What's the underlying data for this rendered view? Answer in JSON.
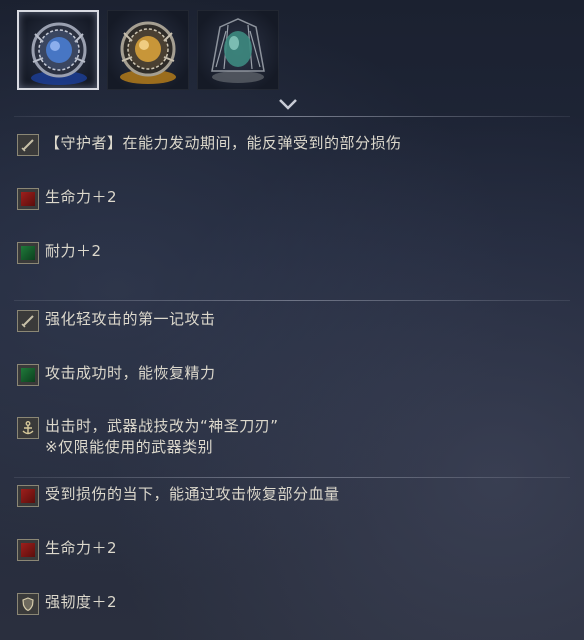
{
  "relics": [
    {
      "icon": "blue-relic-icon",
      "color": "#4a7fd6",
      "selected": true
    },
    {
      "icon": "gold-relic-icon",
      "color": "#d6a03a",
      "selected": false
    },
    {
      "icon": "teal-relic-icon",
      "color": "#4fa89a",
      "selected": false
    }
  ],
  "effect_groups": [
    {
      "effects": [
        {
          "icon": "sword-icon",
          "icon_color": "grey",
          "text": "【守护者】在能力发动期间，能反弹受到的部分损伤"
        },
        {
          "icon": "red-square-icon",
          "icon_color": "red",
          "text": "生命力＋2"
        },
        {
          "icon": "green-square-icon",
          "icon_color": "green",
          "text": "耐力＋2"
        }
      ]
    },
    {
      "effects": [
        {
          "icon": "sword-icon",
          "icon_color": "grey",
          "text": "强化轻攻击的第一记攻击"
        },
        {
          "icon": "green-square-icon",
          "icon_color": "green",
          "text": "攻击成功时，能恢复精力"
        },
        {
          "icon": "anchor-icon",
          "icon_color": "grey",
          "text": "出击时，武器战技改为“神圣刀刃”",
          "note": "※仅限能使用的武器类别"
        }
      ]
    },
    {
      "effects": [
        {
          "icon": "red-square-icon",
          "icon_color": "red",
          "text": "受到损伤的当下，能通过攻击恢复部分血量"
        },
        {
          "icon": "red-square-icon",
          "icon_color": "red",
          "text": "生命力＋2"
        },
        {
          "icon": "shield-icon",
          "icon_color": "grey",
          "text": "强韧度＋2"
        }
      ]
    }
  ]
}
